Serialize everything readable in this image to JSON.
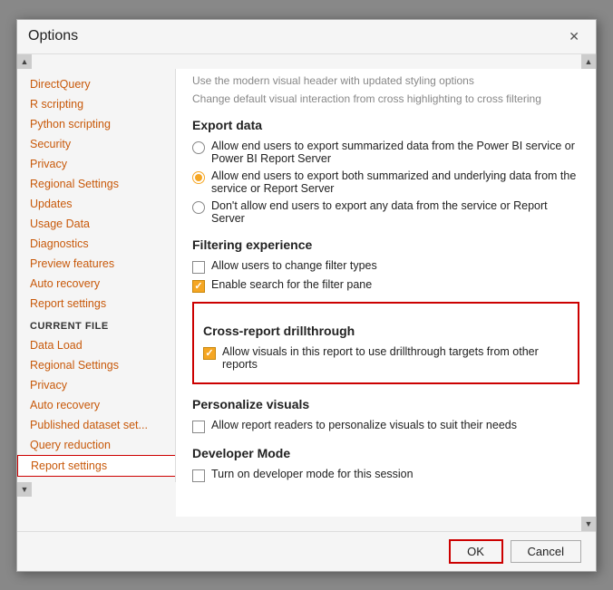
{
  "dialog": {
    "title": "Options",
    "close_label": "✕"
  },
  "sidebar": {
    "global_items": [
      {
        "label": "DirectQuery",
        "selected": false
      },
      {
        "label": "R scripting",
        "selected": false
      },
      {
        "label": "Python scripting",
        "selected": false
      },
      {
        "label": "Security",
        "selected": false
      },
      {
        "label": "Privacy",
        "selected": false
      },
      {
        "label": "Regional Settings",
        "selected": false
      },
      {
        "label": "Updates",
        "selected": false
      },
      {
        "label": "Usage Data",
        "selected": false
      },
      {
        "label": "Diagnostics",
        "selected": false
      },
      {
        "label": "Preview features",
        "selected": false
      },
      {
        "label": "Auto recovery",
        "selected": false
      },
      {
        "label": "Report settings",
        "selected": false
      }
    ],
    "current_file_label": "CURRENT FILE",
    "current_file_items": [
      {
        "label": "Data Load",
        "selected": false
      },
      {
        "label": "Regional Settings",
        "selected": false
      },
      {
        "label": "Privacy",
        "selected": false
      },
      {
        "label": "Auto recovery",
        "selected": false
      },
      {
        "label": "Published dataset set...",
        "selected": false
      },
      {
        "label": "Query reduction",
        "selected": false
      },
      {
        "label": "Report settings",
        "selected": true
      }
    ]
  },
  "content": {
    "top_faded": "Use the modern visual header with updated styling options",
    "sections": [
      {
        "id": "export_data",
        "title": "Export data",
        "options": [
          {
            "type": "radio",
            "checked": false,
            "text": "Allow end users to export summarized data from the Power BI service or Power BI Report Server"
          },
          {
            "type": "radio",
            "checked": true,
            "text": "Allow end users to export both summarized and underlying data from the service or Report Server"
          },
          {
            "type": "radio",
            "checked": false,
            "text": "Don't allow end users to export any data from the service or Report Server"
          }
        ]
      },
      {
        "id": "filtering_experience",
        "title": "Filtering experience",
        "options": [
          {
            "type": "checkbox",
            "checked": false,
            "text": "Allow users to change filter types"
          },
          {
            "type": "checkbox",
            "checked": true,
            "text": "Enable search for the filter pane"
          }
        ]
      },
      {
        "id": "cross_report_drillthrough",
        "title": "Cross-report drillthrough",
        "highlighted": true,
        "options": [
          {
            "type": "checkbox",
            "checked": true,
            "text": "Allow visuals in this report to use drillthrough targets from other reports"
          }
        ]
      },
      {
        "id": "personalize_visuals",
        "title": "Personalize visuals",
        "options": [
          {
            "type": "checkbox",
            "checked": false,
            "text": "Allow report readers to personalize visuals to suit their needs"
          }
        ]
      },
      {
        "id": "developer_mode",
        "title": "Developer Mode",
        "options": [
          {
            "type": "checkbox",
            "checked": false,
            "text": "Turn on developer mode for this session"
          }
        ]
      }
    ]
  },
  "footer": {
    "ok_label": "OK",
    "cancel_label": "Cancel"
  }
}
